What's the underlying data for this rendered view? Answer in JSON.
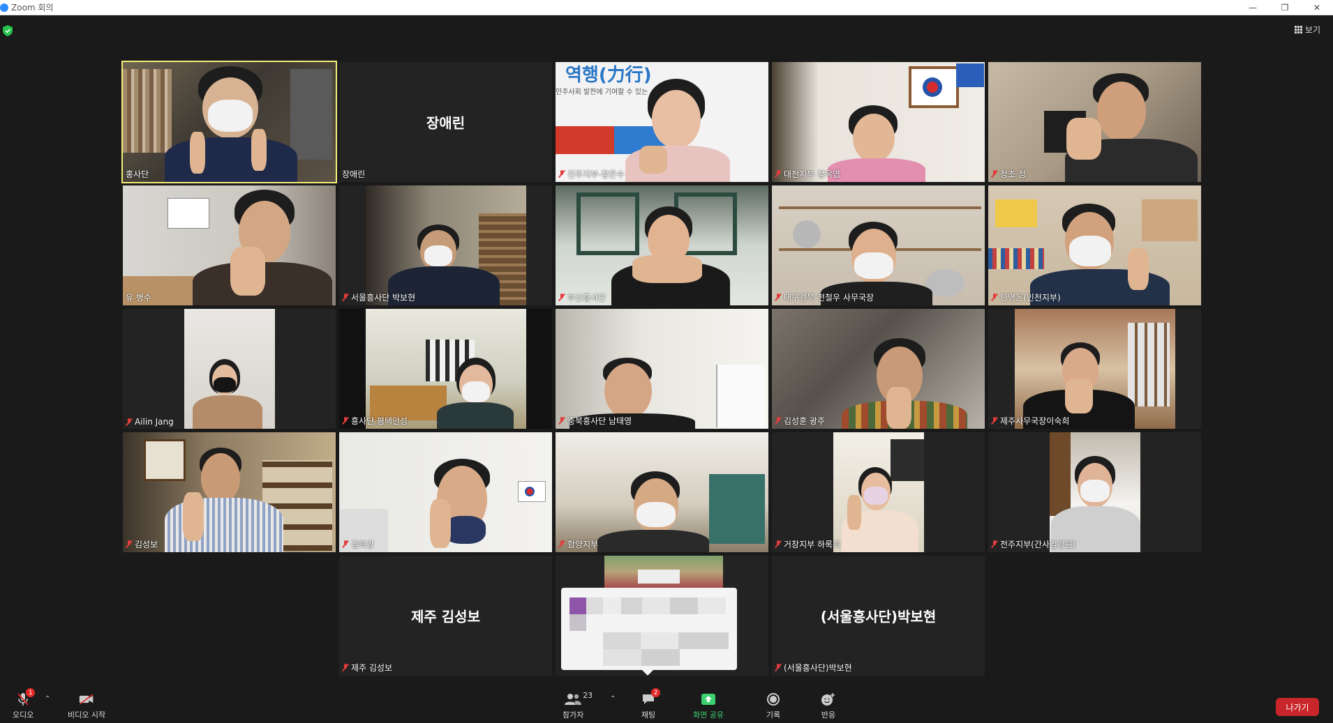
{
  "window": {
    "title": "Zoom 회의"
  },
  "header": {
    "view_label": "보기"
  },
  "tiles": [
    {
      "name": "홍사단",
      "muted": false,
      "active": true
    },
    {
      "name": "장애린",
      "muted": false,
      "center": "장애린"
    },
    {
      "name": "진주지부-장은수",
      "muted": true
    },
    {
      "name": "대전지부 정옥엽",
      "muted": true
    },
    {
      "name": "정조 정",
      "muted": true
    },
    {
      "name": "유 병수",
      "muted": false
    },
    {
      "name": "서울흥사단 박보현",
      "muted": true
    },
    {
      "name": "부산흥사단",
      "muted": true
    },
    {
      "name": "대구경북 전철우 사무국장",
      "muted": true
    },
    {
      "name": "안명돈(인천지부)",
      "muted": true
    },
    {
      "name": "Ailin Jang",
      "muted": true
    },
    {
      "name": "흥사단 평택안성",
      "muted": true
    },
    {
      "name": "충북흥사단 남태영",
      "muted": true
    },
    {
      "name": "김성훈 광주",
      "muted": true
    },
    {
      "name": "제주사무국장이숙희",
      "muted": true
    },
    {
      "name": "김성보",
      "muted": true
    },
    {
      "name": "김희강",
      "muted": true
    },
    {
      "name": "함양지부",
      "muted": true
    },
    {
      "name": "거창지부 하록희",
      "muted": true
    },
    {
      "name": "전주지부(간사김경원)",
      "muted": true
    },
    {
      "name": "제주 김성보",
      "muted": true,
      "center": "제주 김성보"
    },
    {
      "name": "",
      "muted": false
    },
    {
      "name": "(서울흥사단)박보현",
      "muted": true,
      "center": "(서울흥사단)박보현"
    }
  ],
  "tile3_banner": "역행(力行)",
  "tile3_sub": "민주사회 발전에 기여할 수 있는",
  "toolbar": {
    "audio_label": "오디오",
    "audio_badge": "1",
    "video_label": "비디오 시작",
    "participants_label": "참가자",
    "participants_count": "23",
    "chat_label": "채팅",
    "chat_badge": "2",
    "share_label": "화면 공유",
    "record_label": "기록",
    "reactions_label": "반응",
    "leave_label": "나가기"
  },
  "colors": {
    "active_border": "#f6f07a",
    "share_green": "#3cd070",
    "leave_red": "#c8262a",
    "badge_red": "#e02828"
  }
}
